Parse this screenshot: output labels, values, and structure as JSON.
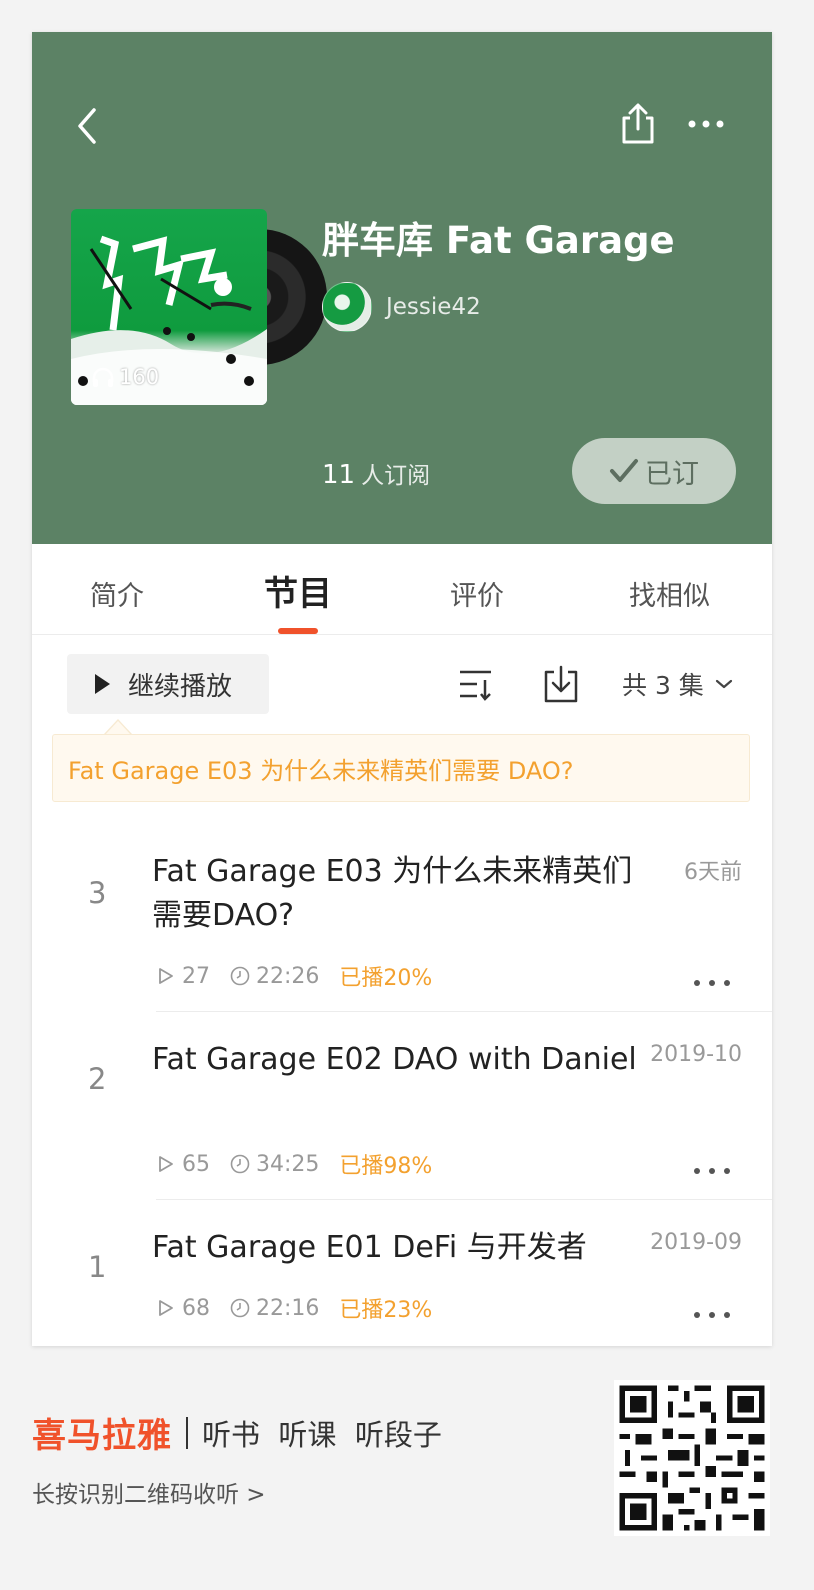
{
  "header": {
    "title": "胖车库 Fat Garage",
    "author": "Jessie42",
    "cover_play_count": "160",
    "subscriber_count": "11",
    "subscriber_suffix": "人订阅",
    "subscribed_label": "已订"
  },
  "tabs": [
    {
      "label": "简介",
      "active": false
    },
    {
      "label": "节目",
      "active": true
    },
    {
      "label": "评价",
      "active": false
    },
    {
      "label": "找相似",
      "active": false
    }
  ],
  "toolbar": {
    "continue_label": "继续播放",
    "total_label": "共 3 集"
  },
  "tip": {
    "text": "Fat Garage E03 为什么未来精英们需要 DAO?"
  },
  "episodes": [
    {
      "num": "3",
      "title": "Fat Garage E03 为什么未来精英们需要DAO?",
      "date": "6天前",
      "plays": "27",
      "duration": "22:26",
      "progress": "已播20%"
    },
    {
      "num": "2",
      "title": "Fat Garage E02 DAO with Daniel",
      "date": "2019-10",
      "plays": "65",
      "duration": "34:25",
      "progress": "已播98%"
    },
    {
      "num": "1",
      "title": "Fat Garage E01 DeFi 与开发者",
      "date": "2019-09",
      "plays": "68",
      "duration": "22:16",
      "progress": "已播23%"
    }
  ],
  "footer": {
    "brand": "喜马拉雅",
    "slogan": "听书  听课  听段子",
    "hint": "长按识别二维码收听 >"
  },
  "colors": {
    "header_bg": "#5c8265",
    "accent": "#f0522b",
    "progress": "#f3a12f"
  },
  "icons": [
    "back-icon",
    "share-icon",
    "more-icon",
    "headphones-icon",
    "check-icon",
    "play-icon",
    "sort-icon",
    "download-icon",
    "chevron-down-icon",
    "play-count-icon",
    "clock-icon",
    "qr-code"
  ]
}
